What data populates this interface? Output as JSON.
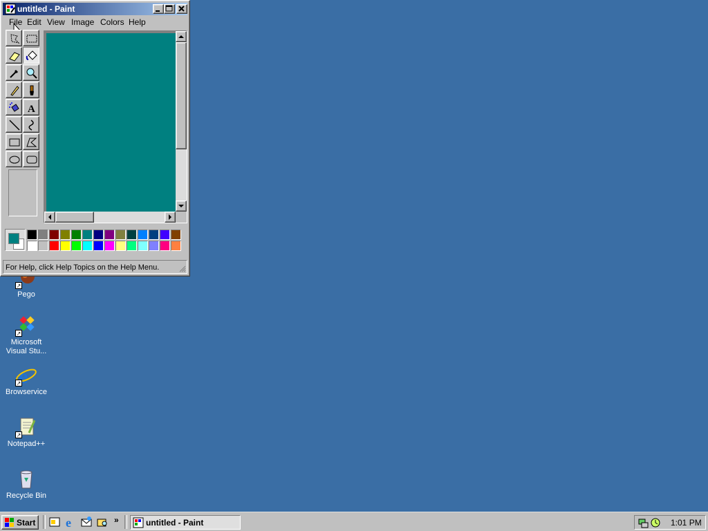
{
  "window": {
    "title": "untitled - Paint",
    "menu": [
      "File",
      "Edit",
      "View",
      "Image",
      "Colors",
      "Help"
    ],
    "status": "For Help, click Help Topics on the Help Menu.",
    "canvas_color": "#008080",
    "foreground_color": "#008080",
    "background_color": "#ffffff"
  },
  "tools": [
    {
      "name": "free-form-select-icon"
    },
    {
      "name": "select-icon"
    },
    {
      "name": "eraser-icon"
    },
    {
      "name": "fill-icon"
    },
    {
      "name": "pick-color-icon"
    },
    {
      "name": "magnifier-icon"
    },
    {
      "name": "pencil-icon"
    },
    {
      "name": "brush-icon"
    },
    {
      "name": "airbrush-icon"
    },
    {
      "name": "text-icon",
      "glyph": "A"
    },
    {
      "name": "line-icon"
    },
    {
      "name": "curve-icon"
    },
    {
      "name": "rectangle-icon"
    },
    {
      "name": "polygon-icon"
    },
    {
      "name": "ellipse-icon"
    },
    {
      "name": "rounded-rectangle-icon"
    }
  ],
  "palette": {
    "row1": [
      "#000000",
      "#808080",
      "#800000",
      "#808000",
      "#008000",
      "#008080",
      "#000080",
      "#800080",
      "#808040",
      "#004040",
      "#0080ff",
      "#004080",
      "#4000ff",
      "#804000"
    ],
    "row2": [
      "#ffffff",
      "#c0c0c0",
      "#ff0000",
      "#ffff00",
      "#00ff00",
      "#00ffff",
      "#0000ff",
      "#ff00ff",
      "#ffff80",
      "#00ff80",
      "#80ffff",
      "#8080ff",
      "#ff0080",
      "#ff8040"
    ]
  },
  "desktop_icons": [
    {
      "label": "Pego",
      "icon": "pego-icon"
    },
    {
      "label": "Microsoft Visual Stu...",
      "icon": "visual-studio-icon"
    },
    {
      "label": "Browservice",
      "icon": "internet-explorer-icon"
    },
    {
      "label": "Notepad++",
      "icon": "notepad-plus-plus-icon"
    },
    {
      "label": "Recycle Bin",
      "icon": "recycle-bin-icon"
    }
  ],
  "taskbar": {
    "start_label": "Start",
    "quick_launch_more": "»",
    "task_label": "untitled - Paint",
    "clock": "1:01 PM"
  }
}
